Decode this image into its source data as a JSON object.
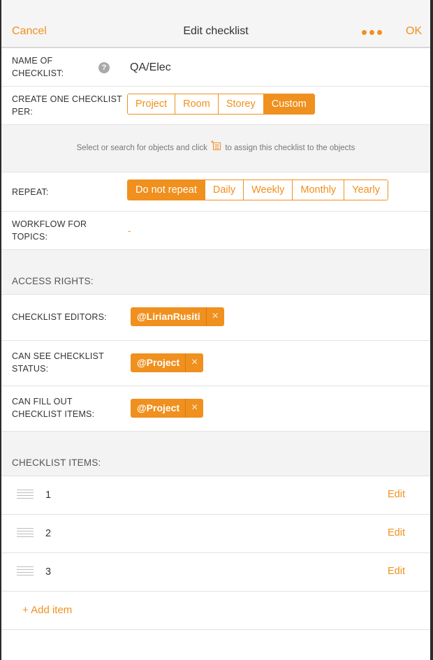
{
  "header": {
    "cancel_label": "Cancel",
    "title": "Edit checklist",
    "ok_label": "OK",
    "more_icon": "ellipsis-icon"
  },
  "name_row": {
    "label_line1": "NAME OF",
    "label_line2": "CHECKLIST:",
    "help_glyph": "?",
    "value": "QA/Elec"
  },
  "per_row": {
    "label_line1": "CREATE ONE CHECKLIST",
    "label_line2": "PER:",
    "options": [
      "Project",
      "Room",
      "Storey",
      "Custom"
    ],
    "selected": "Custom"
  },
  "hint": {
    "before": "Select or search for objects and click",
    "after": "to assign this checklist to the objects",
    "icon": "assign-list-icon"
  },
  "repeat_row": {
    "label": "REPEAT:",
    "options": [
      "Do not repeat",
      "Daily",
      "Weekly",
      "Monthly",
      "Yearly"
    ],
    "selected": "Do not repeat"
  },
  "workflow_row": {
    "label_line1": "WORKFLOW FOR",
    "label_line2": "TOPICS:",
    "value": "-"
  },
  "access": {
    "title": "ACCESS RIGHTS:",
    "editors_label": "CHECKLIST EDITORS:",
    "editors_chip": "@LirianRusiti",
    "status_label_line1": "CAN SEE CHECKLIST",
    "status_label_line2": "STATUS:",
    "status_chip": "@Project",
    "fill_label_line1": "CAN FILL OUT",
    "fill_label_line2": "CHECKLIST ITEMS:",
    "fill_chip": "@Project",
    "remove_glyph": "×"
  },
  "items": {
    "title": "CHECKLIST ITEMS:",
    "list": [
      {
        "number": "1",
        "edit_label": "Edit"
      },
      {
        "number": "2",
        "edit_label": "Edit"
      },
      {
        "number": "3",
        "edit_label": "Edit"
      }
    ],
    "add_label": "+ Add item"
  },
  "colors": {
    "accent": "#f0901e",
    "background": "#f3f3f3"
  }
}
